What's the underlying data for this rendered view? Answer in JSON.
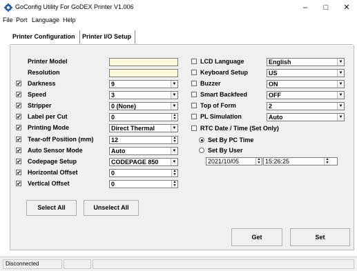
{
  "window": {
    "title": "GoConfig Utility For GoDEX Printer  V1.006",
    "minimize": "–",
    "maximize": "□",
    "close": "✕"
  },
  "menu": [
    "File",
    "Port",
    "Language",
    "Help"
  ],
  "tabs": [
    {
      "label": "Printer Configuration",
      "active": true
    },
    {
      "label": "Printer I/O Setup",
      "active": false
    }
  ],
  "left_settings": [
    {
      "label": "Printer Model",
      "checked": null,
      "value": "",
      "control": "text-yellow"
    },
    {
      "label": "Resolution",
      "checked": null,
      "value": "",
      "control": "text-yellow"
    },
    {
      "label": "Darkness",
      "checked": true,
      "value": "9",
      "control": "dropdown"
    },
    {
      "label": "Speed",
      "checked": true,
      "value": "3",
      "control": "dropdown"
    },
    {
      "label": "Stripper",
      "checked": true,
      "value": "0 (None)",
      "control": "dropdown"
    },
    {
      "label": "Label per Cut",
      "checked": true,
      "value": "0",
      "control": "spin"
    },
    {
      "label": "Printing Mode",
      "checked": true,
      "value": "Direct Thermal",
      "control": "dropdown"
    },
    {
      "label": "Tear-off Position (mm)",
      "checked": true,
      "value": "12",
      "control": "spin"
    },
    {
      "label": "Auto Sensor Mode",
      "checked": true,
      "value": "Auto",
      "control": "dropdown"
    },
    {
      "label": "Codepage Setup",
      "checked": true,
      "value": "CODEPAGE 850",
      "control": "dropdown"
    },
    {
      "label": "Horizontal Offset",
      "checked": true,
      "value": "0",
      "control": "spin"
    },
    {
      "label": "Vertical Offset",
      "checked": true,
      "value": "0",
      "control": "spin"
    }
  ],
  "right_settings": [
    {
      "label": "LCD Language",
      "checked": false,
      "value": "English"
    },
    {
      "label": "Keyboard Setup",
      "checked": false,
      "value": "US"
    },
    {
      "label": "Buzzer",
      "checked": false,
      "value": "ON"
    },
    {
      "label": "Smart Backfeed",
      "checked": false,
      "value": "OFF"
    },
    {
      "label": "Top of Form",
      "checked": false,
      "value": "2"
    },
    {
      "label": "PL Simulation",
      "checked": false,
      "value": "Auto"
    }
  ],
  "rtc": {
    "label": "RTC Date / Time (Set Only)",
    "checked": false,
    "option_pc": "Set By PC Time",
    "option_user": "Set By User",
    "selected": "pc",
    "date": "2021/10/05",
    "time": "15:26:25"
  },
  "buttons": {
    "select_all": "Select All",
    "unselect_all": "Unselect All",
    "get": "Get",
    "set": "Set"
  },
  "status": {
    "connection": "Disconnected",
    "cell2": "",
    "cell3": ""
  },
  "glyphs": {
    "check": "✔",
    "dropdown": "▼",
    "spin_up": "▲",
    "spin_down": "▼"
  }
}
